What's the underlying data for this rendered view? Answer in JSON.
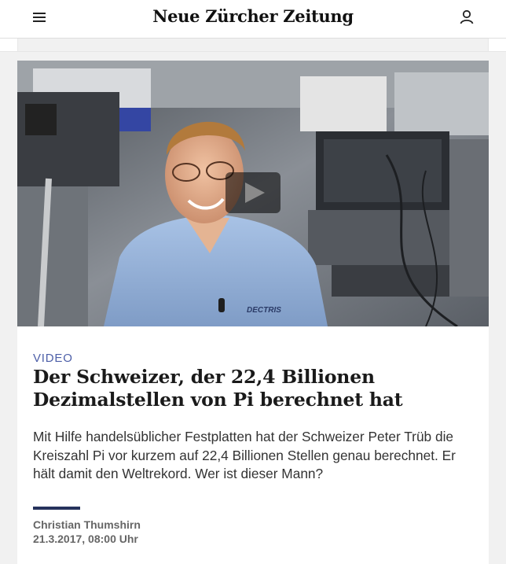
{
  "header": {
    "logo_text": "Neue Zürcher Zeitung",
    "menu_icon": "hamburger-menu-icon",
    "user_icon": "user-account-icon"
  },
  "article": {
    "kicker": "VIDEO",
    "title": "Der Schweizer, der 22,4 Billionen Dezimalstellen von Pi berechnet hat",
    "lead": "Mit Hilfe handelsüblicher Festplatten hat der Schweizer Peter Trüb die Kreiszahl Pi vor kurzem auf 22,4 Billionen Stellen genau berechnet. Er hält damit den Weltrekord. Wer ist dieser Mann?",
    "author": "Christian Thumshirn",
    "date": "21.3.2017, 08:00 Uhr"
  },
  "video": {
    "play_icon": "play-icon",
    "shirt_text": "DECTRIS"
  },
  "colors": {
    "kicker": "#4d5fa8",
    "divider": "#26325c",
    "background": "#f1f1f1"
  }
}
